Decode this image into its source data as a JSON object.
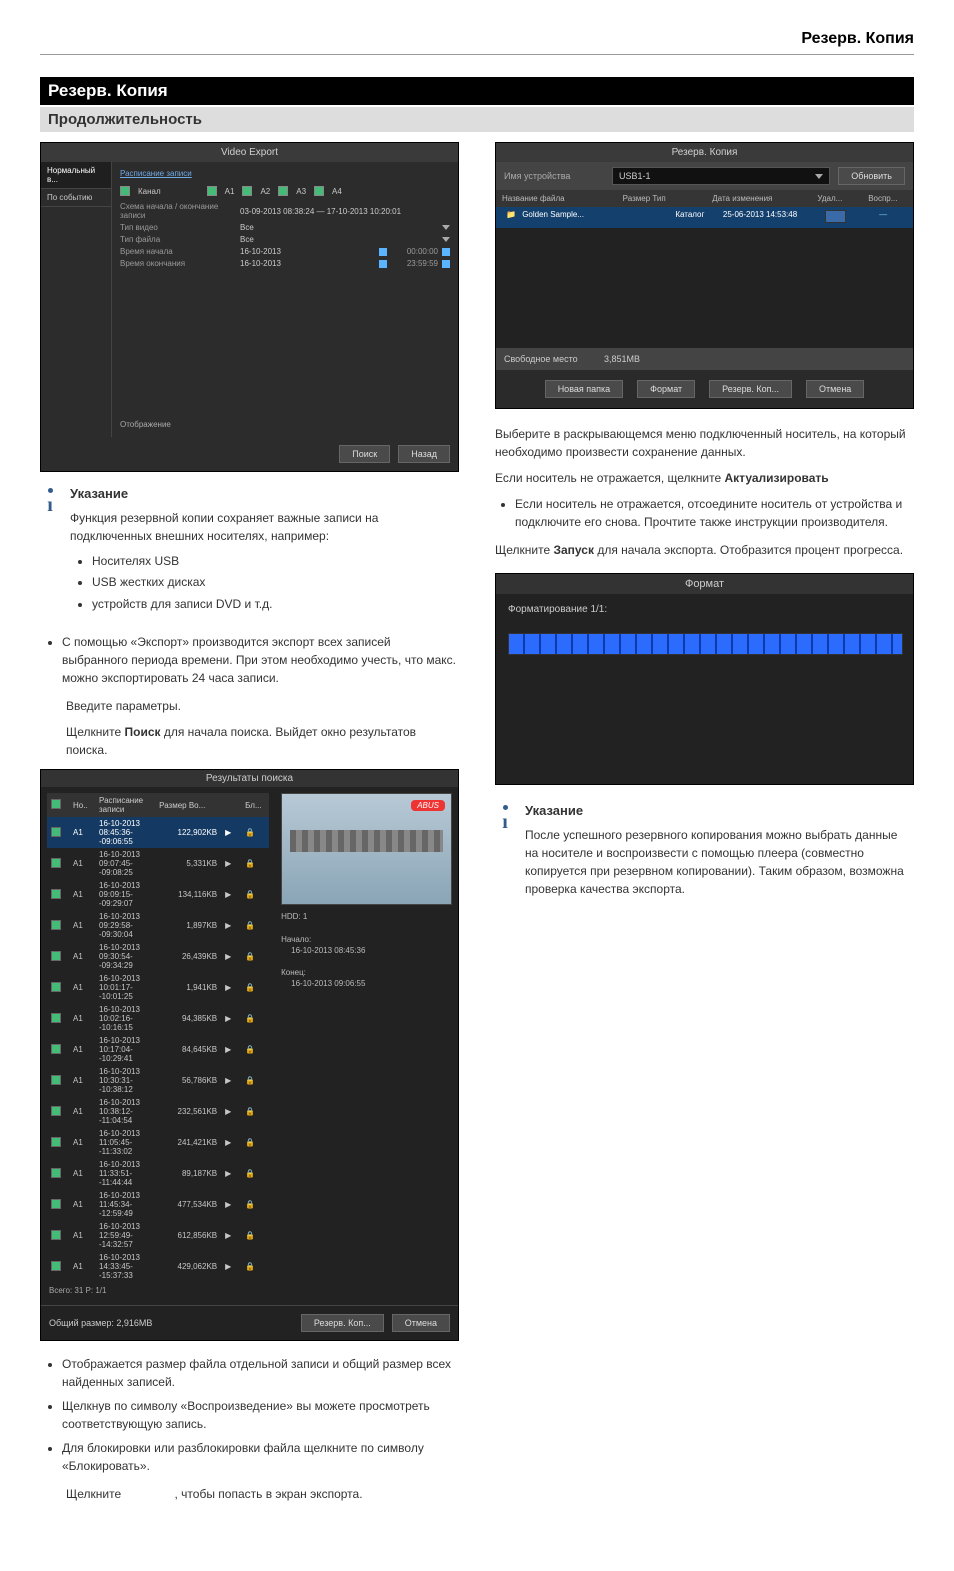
{
  "header": {
    "title": "Резерв. Копия"
  },
  "bar": {
    "title": "Резерв. Копия",
    "subtitle": "Продолжительность"
  },
  "video_export": {
    "title": "Video Export",
    "side": {
      "item1": "Нормальный в...",
      "item2": "По событию"
    },
    "tab": "Расписание записи",
    "channel_label": "Канал",
    "ch": [
      "A1",
      "A2",
      "A3",
      "A4"
    ],
    "rows": {
      "r1_lab": "Схема начала / окончание записи",
      "r1_val": "03-09-2013 08:38:24 — 17-10-2013 10:20:01",
      "r2_lab": "Тип видео",
      "r2_val": "Все",
      "r3_lab": "Тип файла",
      "r3_val": "Все",
      "r4_lab": "Время начала",
      "r4_val": "16-10-2013",
      "r4_time": "00:00:00",
      "r5_lab": "Время окончания",
      "r5_val": "16-10-2013",
      "r5_time": "23:59:59"
    },
    "footer_label": "Отображение",
    "btn_search": "Поиск",
    "btn_back": "Назад"
  },
  "note1": {
    "title": "Указание",
    "p1": "Функция резервной копии сохраняет важные записи на подключенных внешних носителях, например:",
    "li1": "Носителях USB",
    "li2": "USB жестких дисках",
    "li3": "устройств для записи DVD и т.д."
  },
  "export_bullet": "С помощью «Экспорт» производится экспорт всех записей выбранного периода времени. При этом необходимо учесть, что макс. можно экспортировать 24 часа записи.",
  "enter_params": "Введите параметры.",
  "click_search_pre": "Щелкните ",
  "click_search_bold": "Поиск",
  "click_search_post": " для начала поиска. Выйдет окно результатов поиска.",
  "results": {
    "title": "Результаты поиска",
    "cols": {
      "c0": "Но..",
      "c1": "Расписание записи",
      "c2": "Размер Во...",
      "c3": "Бл..."
    },
    "rows": [
      {
        "ch": "A1",
        "t": "16-10-2013 08:45:36--09:06:55",
        "s": "122,902KB"
      },
      {
        "ch": "A1",
        "t": "16-10-2013 09:07:45--09:08:25",
        "s": "5,331KB"
      },
      {
        "ch": "A1",
        "t": "16-10-2013 09:09:15--09:29:07",
        "s": "134,116KB"
      },
      {
        "ch": "A1",
        "t": "16-10-2013 09:29:58--09:30:04",
        "s": "1,897KB"
      },
      {
        "ch": "A1",
        "t": "16-10-2013 09:30:54--09:34:29",
        "s": "26,439KB"
      },
      {
        "ch": "A1",
        "t": "16-10-2013 10:01:17--10:01:25",
        "s": "1,941KB"
      },
      {
        "ch": "A1",
        "t": "16-10-2013 10:02:16--10:16:15",
        "s": "94,385KB"
      },
      {
        "ch": "A1",
        "t": "16-10-2013 10:17:04--10:29:41",
        "s": "84,645KB"
      },
      {
        "ch": "A1",
        "t": "16-10-2013 10:30:31--10:38:12",
        "s": "56,786KB"
      },
      {
        "ch": "A1",
        "t": "16-10-2013 10:38:12--11:04:54",
        "s": "232,561KB"
      },
      {
        "ch": "A1",
        "t": "16-10-2013 11:05:45--11:33:02",
        "s": "241,421KB"
      },
      {
        "ch": "A1",
        "t": "16-10-2013 11:33:51--11:44:44",
        "s": "89,187KB"
      },
      {
        "ch": "A1",
        "t": "16-10-2013 11:45:34--12:59:49",
        "s": "477,534KB"
      },
      {
        "ch": "A1",
        "t": "16-10-2013 12:59:49--14:32:57",
        "s": "612,856KB"
      },
      {
        "ch": "A1",
        "t": "16-10-2013 14:33:45--15:37:33",
        "s": "429,062KB"
      }
    ],
    "total_line": "Всего: 31  P: 1/1",
    "hdd": "HDD: 1",
    "start_lab": "Начало:",
    "start_val": "16-10-2013 08:45:36",
    "end_lab": "Конец:",
    "end_val": "16-10-2013 09:06:55",
    "total_size": "Общий размер: 2,916MB",
    "btn_backup": "Резерв. Коп...",
    "btn_cancel": "Отмена"
  },
  "after_results": {
    "li1": "Отображается размер файла отдельной записи и общий размер всех найденных записей.",
    "li2": "Щелкнув по символу «Воспроизведение» вы можете просмотреть соответствующую запись.",
    "li3": "Для блокировки или разблокировки файла щелкните по символу «Блокировать».",
    "click_export_pre": "Щелкните ",
    "click_export_post": ", чтобы попасть в экран экспорта."
  },
  "backup": {
    "title": "Резерв. Копия",
    "device_lab": "Имя устройства",
    "device_val": "USB1-1",
    "refresh": "Обновить",
    "cols": {
      "c1": "Название файла",
      "c2": "Размер Тип",
      "c3": "Дата изменения",
      "c4": "Удал...",
      "c5": "Воспр..."
    },
    "file": {
      "name": "Golden Sample...",
      "type": "Каталог",
      "date": "25-06-2013 14:53:48"
    },
    "free_lab": "Свободное место",
    "free_val": "3,851МВ",
    "btn_newdir": "Новая папка",
    "btn_format": "Формат",
    "btn_backup": "Резерв. Коп...",
    "btn_cancel": "Отмена"
  },
  "right_text": {
    "p1": "Выберите в раскрывающемся меню подключенный носитель, на который необходимо произвести сохранение данных.",
    "p2_pre": "Если носитель не отражается, щелкните ",
    "p2_bold": "Актуализировать",
    "li1": "Если носитель не отражается, отсоедините носитель от устройства и подключите его снова. Прочтите также инструкции производителя.",
    "p3_pre": "Щелкните ",
    "p3_bold": "Запуск",
    "p3_post": " для начала экспорта. Отобразится процент прогресса."
  },
  "format": {
    "title": "Формат",
    "label": "Форматирование 1/1:"
  },
  "note2": {
    "title": "Указание",
    "body": "После успешного резервного копирования можно выбрать данные на носителе и воспроизвести с помощью плеера (совместно копируется при резервном копировании). Таким образом, возможна проверка качества экспорта."
  }
}
